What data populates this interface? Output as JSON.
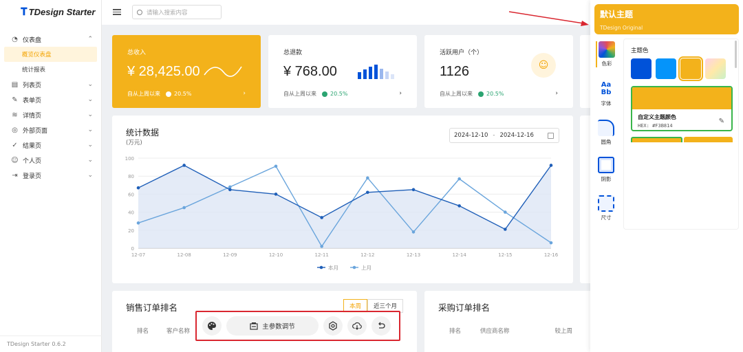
{
  "sidebar": {
    "logo": "TDesign Starter",
    "items": [
      {
        "label": "仪表盘",
        "icon": "dashboard-icon",
        "glyph": "◔",
        "chevron": "⌃"
      },
      {
        "label": "列表页",
        "icon": "list-icon",
        "glyph": "▤",
        "chevron": "⌄"
      },
      {
        "label": "表单页",
        "icon": "edit-icon",
        "glyph": "✎",
        "chevron": "⌄"
      },
      {
        "label": "详情页",
        "icon": "layers-icon",
        "glyph": "≋",
        "chevron": "⌄"
      },
      {
        "label": "外部页面",
        "icon": "globe-icon",
        "glyph": "◎",
        "chevron": "⌄"
      },
      {
        "label": "结果页",
        "icon": "check-circle-icon",
        "glyph": "✓",
        "chevron": "⌄"
      },
      {
        "label": "个人页",
        "icon": "user-circle-icon",
        "glyph": "☺",
        "chevron": "⌄"
      },
      {
        "label": "登录页",
        "icon": "login-icon",
        "glyph": "⇥",
        "chevron": "⌄"
      }
    ],
    "sub_items": [
      "概览仪表盘",
      "统计报表"
    ],
    "version": "TDesign Starter 0.6.2"
  },
  "header": {
    "search_placeholder": "请输入搜索内容"
  },
  "stats": [
    {
      "title": "总收入",
      "value": "¥ 28,425.00",
      "foot": "自从上周以来",
      "pct": "20.5%",
      "arrow": "›"
    },
    {
      "title": "总退款",
      "value": "¥ 768.00",
      "foot": "自从上周以来",
      "pct": "20.5%",
      "arrow": "›"
    },
    {
      "title": "活跃用户（个）",
      "value": "1126",
      "foot": "自从上周以来",
      "pct": "20.5%",
      "arrow": "›"
    }
  ],
  "chart_data": {
    "type": "line",
    "title": "统计数据",
    "subtitle": "(万元)",
    "x": [
      "12-07",
      "12-08",
      "12-09",
      "12-10",
      "12-11",
      "12-12",
      "12-13",
      "12-14",
      "12-15",
      "12-16"
    ],
    "series": [
      {
        "name": "本月",
        "values": [
          67,
          92,
          65,
          60,
          34,
          62,
          65,
          47,
          21,
          92
        ]
      },
      {
        "name": "上月",
        "values": [
          28,
          45,
          68,
          91,
          2,
          78,
          18,
          77,
          40,
          6
        ]
      }
    ],
    "ylim": [
      0,
      100
    ],
    "yticks": [
      0,
      20,
      40,
      60,
      80,
      100
    ],
    "grid": true,
    "legend": "bottom",
    "colors": {
      "current": "#1f5fb8",
      "previous": "#6aa5dc",
      "fill": "#dde6f5"
    }
  },
  "date_range": {
    "start": "2024-12-10",
    "sep": "-",
    "end": "2024-12-16"
  },
  "sales": {
    "title": "销售订单排名",
    "tabs": [
      "本周",
      "近三个月"
    ],
    "columns": [
      "排名",
      "客户名称"
    ]
  },
  "purchase": {
    "title": "采购订单排名",
    "columns": [
      "排名",
      "供应商名称",
      "较上周"
    ]
  },
  "toolbar": {
    "main_label": "主参数调节",
    "buttons": [
      "palette-icon",
      "setting-icon",
      "download-icon",
      "undo-icon"
    ]
  },
  "theme_panel": {
    "title": "默认主题",
    "subtitle": "TDesign Original",
    "rail": [
      "色彩",
      "字体",
      "圆角",
      "阴影",
      "尺寸"
    ],
    "section": "主题色",
    "swatch_colors": [
      "#0052d9",
      "#0594fa",
      "#f3b21b",
      "#e6a3ff"
    ],
    "custom_name": "自定义主题颜色",
    "custom_hex": "HEX: #F3B814",
    "edit_icon": "✎"
  },
  "colors": {
    "brand": "#f3b21b",
    "success": "#2ba471",
    "annotation": "#d9262f"
  }
}
